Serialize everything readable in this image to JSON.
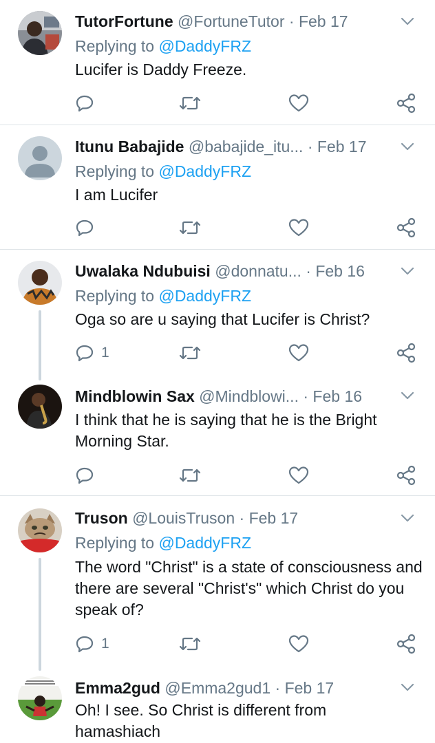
{
  "tweets": [
    {
      "name": "TutorFortune",
      "handle": "@FortuneTutor",
      "separator": "·",
      "date": "Feb 17",
      "replying_prefix": "Replying to",
      "replying_mention": "@DaddyFRZ",
      "text": "Lucifer is Daddy Freeze.",
      "reply_count": ""
    },
    {
      "name": "Itunu Babajide",
      "handle": "@babajide_itu...",
      "separator": "·",
      "date": "Feb 17",
      "replying_prefix": "Replying to",
      "replying_mention": "@DaddyFRZ",
      "text": "I am Lucifer",
      "reply_count": ""
    },
    {
      "name": "Uwalaka Ndubuisi",
      "handle": "@donnatu...",
      "separator": "·",
      "date": "Feb 16",
      "replying_prefix": "Replying to",
      "replying_mention": "@DaddyFRZ",
      "text": "Oga so are u saying that Lucifer is Christ?",
      "reply_count": "1"
    },
    {
      "name": "Mindblowin Sax",
      "handle": "@Mindblowi...",
      "separator": "·",
      "date": "Feb 16",
      "text": "I think that he is saying that he is the Bright Morning Star.",
      "reply_count": ""
    },
    {
      "name": "Truson",
      "handle": "@LouisTruson",
      "separator": "·",
      "date": "Feb 17",
      "replying_prefix": "Replying to",
      "replying_mention": "@DaddyFRZ",
      "text": "The word \"Christ\" is a state of consciousness and there are several \"Christ's\" which Christ do you speak of?",
      "reply_count": "1"
    },
    {
      "name": "Emma2gud",
      "handle": "@Emma2gud1",
      "separator": "·",
      "date": "Feb 17",
      "text": "Oh! I see. So Christ is different from hamashiach"
    }
  ],
  "colors": {
    "link": "#1da1f2",
    "secondary_text": "#657786",
    "divider": "#dfe4e8",
    "thread_line": "#ccd6dd"
  },
  "icons": [
    "reply-icon",
    "retweet-icon",
    "like-icon",
    "share-icon",
    "chevron-down-icon"
  ]
}
